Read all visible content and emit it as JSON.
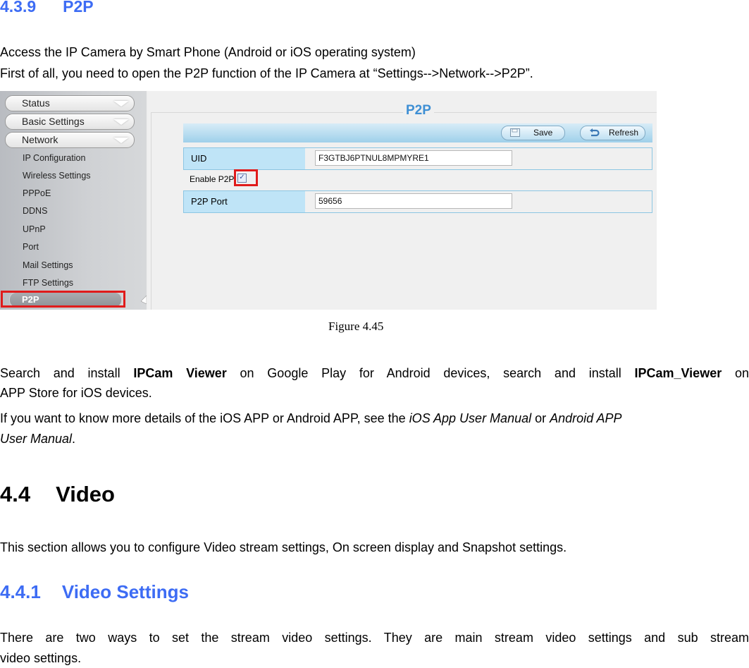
{
  "section_439": {
    "number": "4.3.9",
    "title": "P2P",
    "line1": "Access the IP Camera by Smart Phone (Android or iOS operating system)",
    "line2": "First of all, you need to open the P2P function of the IP Camera at “Settings-->Network-->P2P”."
  },
  "figure": {
    "sidebar": {
      "menus": [
        "Status",
        "Basic Settings",
        "Network"
      ],
      "network_items": [
        "IP Configuration",
        "Wireless Settings",
        "PPPoE",
        "DDNS",
        "UPnP",
        "Port",
        "Mail Settings",
        "FTP Settings"
      ],
      "active_item": "P2P"
    },
    "panel": {
      "title": "P2P",
      "save_label": "Save",
      "refresh_label": "Refresh",
      "uid_label": "UID",
      "uid_value": "F3GTBJ6PTNUL8MPMYRE1",
      "enable_label": "Enable P2P",
      "enable_checked": true,
      "port_label": "P2P Port",
      "port_value": "59656"
    },
    "caption": "Figure 4.45",
    "highlight_color": "#e01b1b"
  },
  "install_para": {
    "t1": "Search and install ",
    "b1": "IPCam Viewer",
    "t2": " on Google Play for Android devices, search and install ",
    "b2": "IPCam_Viewer",
    "t3": " on",
    "line2": "APP Store for iOS devices.",
    "t4": "If you want to know more details of the iOS APP or Android APP, see the ",
    "i1": "iOS App User Manual",
    "t5": " or ",
    "i2": "Android APP",
    "i3": "User Manual",
    "t6": "."
  },
  "section_44": {
    "number": "4.4",
    "title": "Video",
    "text": "This section allows you to configure Video stream settings, On screen display and Snapshot settings."
  },
  "section_441": {
    "number": "4.4.1",
    "title": "Video Settings",
    "line1": "There are two ways to set the stream video settings. They are main stream video settings and sub stream",
    "line2": "video settings."
  },
  "colors": {
    "heading_blue": "#3d6cf4"
  }
}
